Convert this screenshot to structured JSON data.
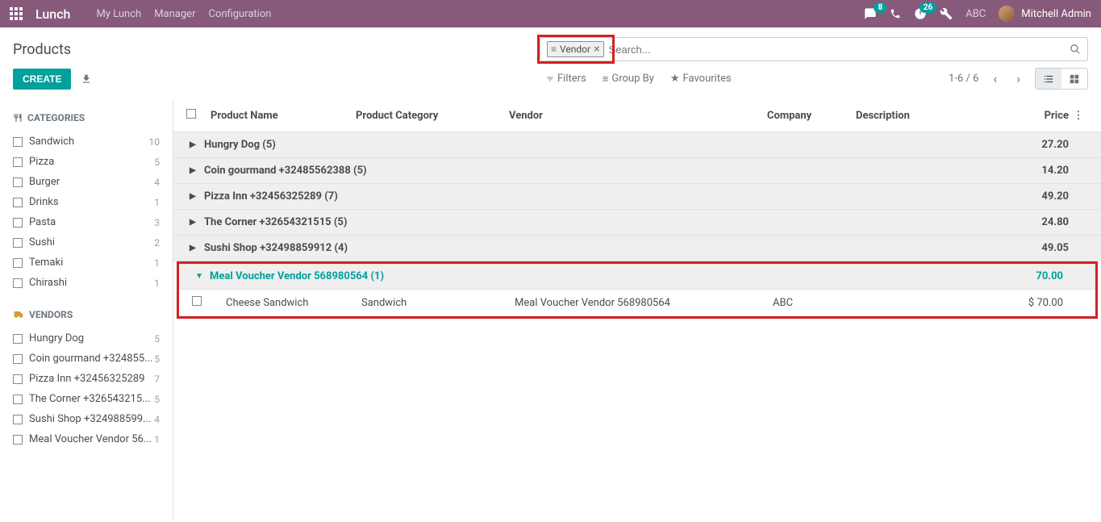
{
  "navbar": {
    "app_title": "Lunch",
    "links": [
      "My Lunch",
      "Manager",
      "Configuration"
    ],
    "badge_chat": "8",
    "badge_activity": "26",
    "user_company": "ABC",
    "user_name": "Mitchell Admin"
  },
  "control": {
    "breadcrumb": "Products",
    "create": "CREATE",
    "search_facet": "Vendor",
    "search_placeholder": "Search...",
    "filters": "Filters",
    "groupby": "Group By",
    "favourites": "Favourites",
    "pager": "1-6 / 6"
  },
  "sidebar": {
    "categories_title": "CATEGORIES",
    "categories": [
      {
        "label": "Sandwich",
        "count": "10"
      },
      {
        "label": "Pizza",
        "count": "5"
      },
      {
        "label": "Burger",
        "count": "4"
      },
      {
        "label": "Drinks",
        "count": "1"
      },
      {
        "label": "Pasta",
        "count": "3"
      },
      {
        "label": "Sushi",
        "count": "2"
      },
      {
        "label": "Temaki",
        "count": "1"
      },
      {
        "label": "Chirashi",
        "count": "1"
      }
    ],
    "vendors_title": "VENDORS",
    "vendors": [
      {
        "label": "Hungry Dog",
        "count": "5"
      },
      {
        "label": "Coin gourmand +324855...",
        "count": "5"
      },
      {
        "label": "Pizza Inn +32456325289",
        "count": "7"
      },
      {
        "label": "The Corner +326543215...",
        "count": "5"
      },
      {
        "label": "Sushi Shop +324988599...",
        "count": "4"
      },
      {
        "label": "Meal Voucher Vendor 56...",
        "count": "1"
      }
    ]
  },
  "table": {
    "headers": {
      "name": "Product Name",
      "category": "Product Category",
      "vendor": "Vendor",
      "company": "Company",
      "description": "Description",
      "price": "Price"
    },
    "groups": [
      {
        "label": "Hungry Dog (5)",
        "price": "27.20",
        "expanded": false
      },
      {
        "label": "Coin gourmand +32485562388 (5)",
        "price": "14.20",
        "expanded": false
      },
      {
        "label": "Pizza Inn +32456325289 (7)",
        "price": "49.20",
        "expanded": false
      },
      {
        "label": "The Corner +32654321515 (5)",
        "price": "24.80",
        "expanded": false
      },
      {
        "label": "Sushi Shop +32498859912 (4)",
        "price": "49.05",
        "expanded": false
      },
      {
        "label": "Meal Voucher Vendor 568980564 (1)",
        "price": "70.00",
        "expanded": true
      }
    ],
    "detail_row": {
      "name": "Cheese Sandwich",
      "category": "Sandwich",
      "vendor": "Meal Voucher Vendor 568980564",
      "company": "ABC",
      "description": "",
      "price": "$ 70.00"
    }
  }
}
